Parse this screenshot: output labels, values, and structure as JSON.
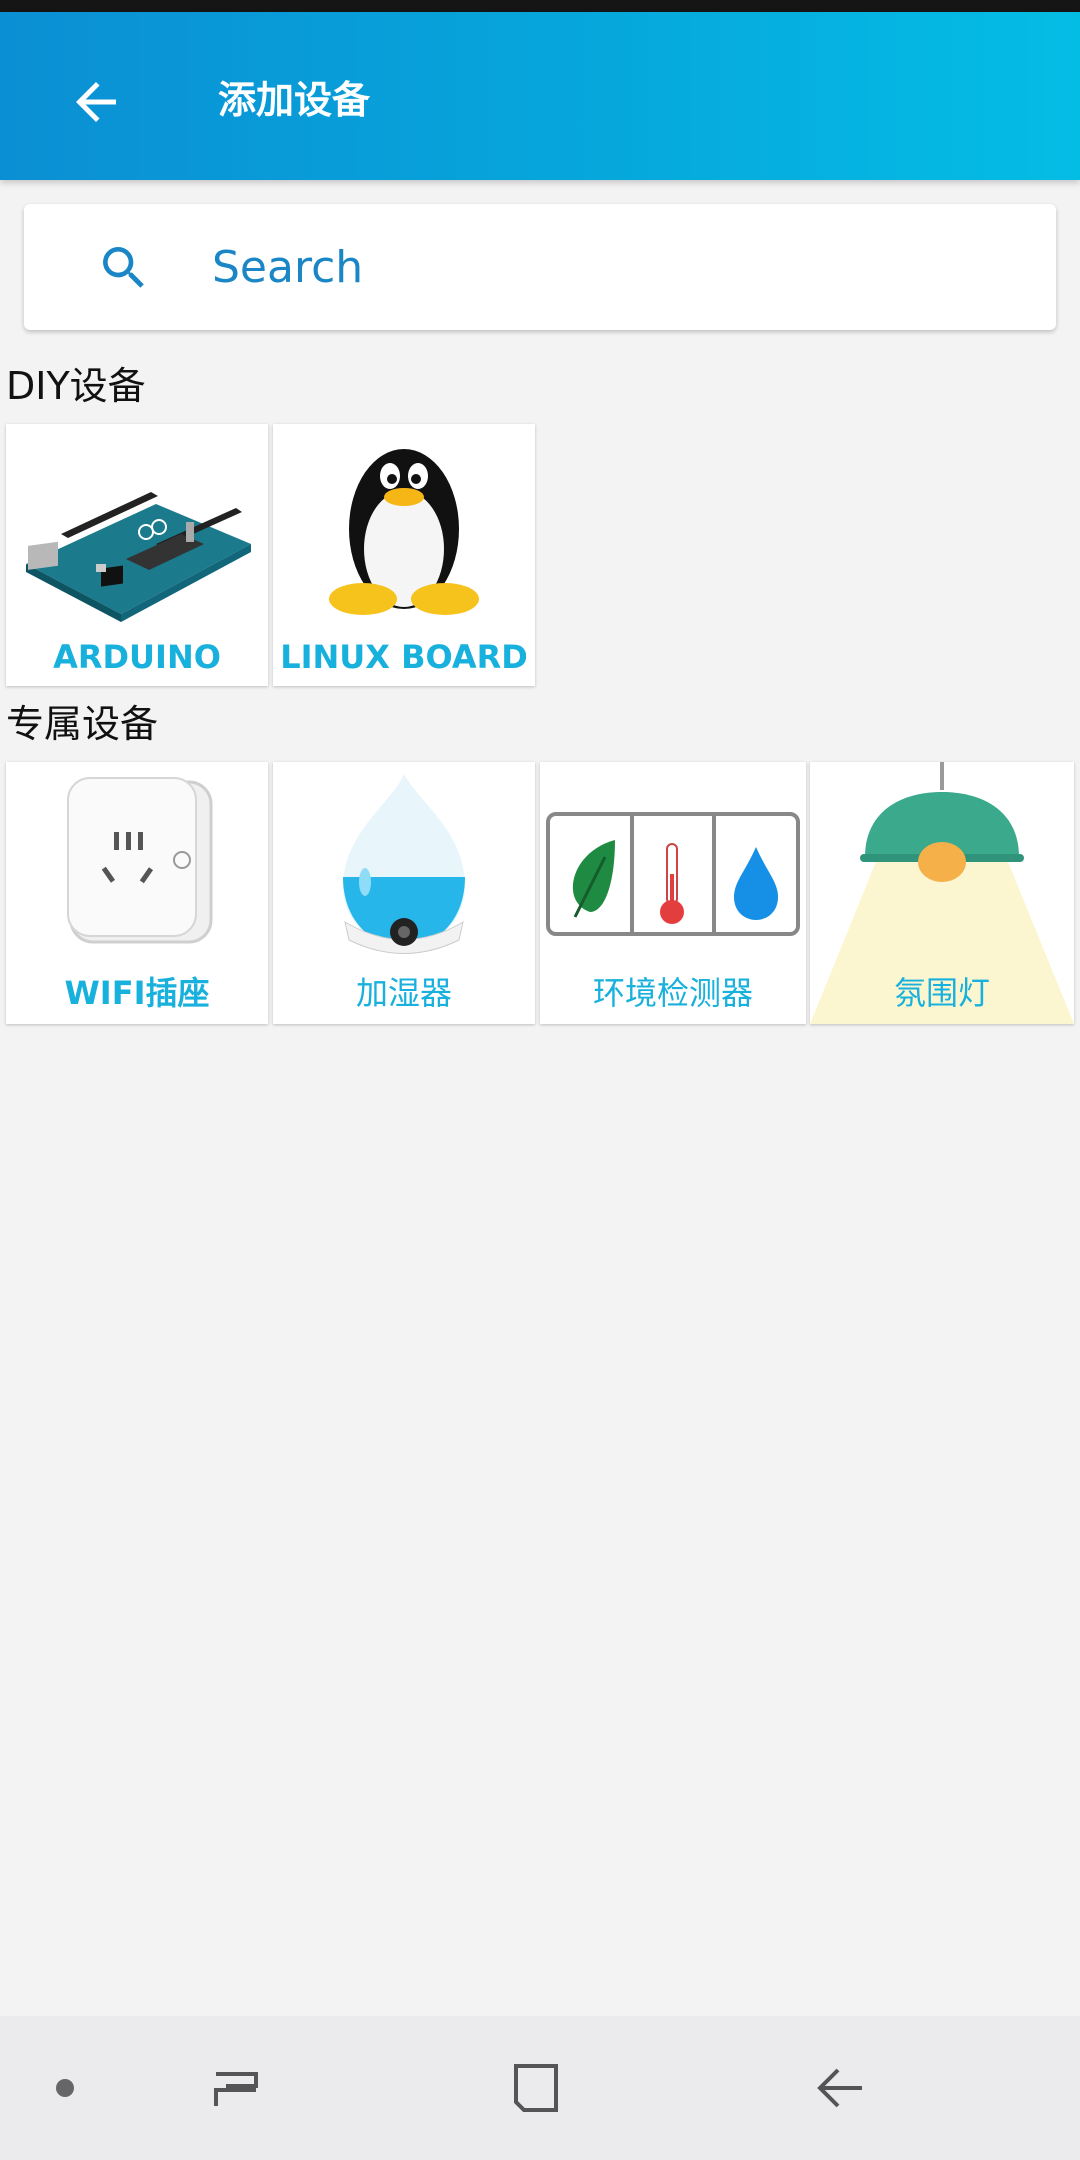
{
  "header": {
    "title": "添加设备",
    "back_icon": "arrow-left-icon"
  },
  "search": {
    "placeholder": "Search",
    "icon": "search-icon",
    "accent_color": "#1a86c6"
  },
  "sections": [
    {
      "title": "DIY设备",
      "items": [
        {
          "label": "ARDUINO",
          "icon": "arduino-board-icon"
        },
        {
          "label": "LINUX BOARD",
          "icon": "tux-penguin-icon"
        }
      ]
    },
    {
      "title": "专属设备",
      "items": [
        {
          "label": "WIFI插座",
          "icon": "smart-plug-icon"
        },
        {
          "label": "加湿器",
          "icon": "humidifier-icon"
        },
        {
          "label": "环境检测器",
          "icon": "environment-sensor-icon"
        },
        {
          "label": "氛围灯",
          "icon": "pendant-lamp-icon"
        }
      ]
    }
  ],
  "nav_bar": {
    "items": [
      "dot-icon",
      "recent-apps-icon",
      "home-icon",
      "back-icon"
    ]
  },
  "colors": {
    "app_bar_start": "#0b8fd4",
    "app_bar_end": "#04bde5",
    "tile_label": "#18b0dc",
    "background": "#f4f3f4"
  }
}
